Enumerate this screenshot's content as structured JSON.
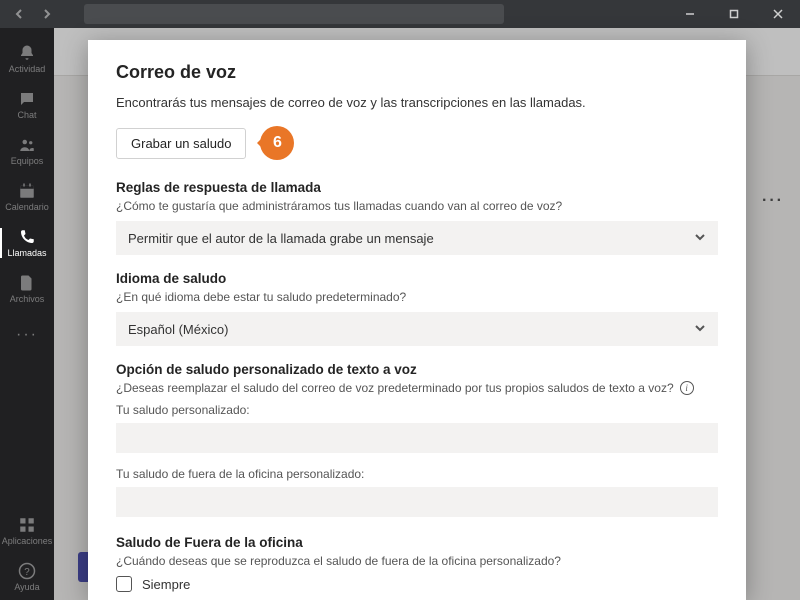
{
  "titlebar": {
    "nav_back_icon": "chevron-left",
    "nav_fwd_icon": "chevron-right"
  },
  "rail": {
    "items": [
      {
        "label": "Actividad",
        "icon": "bell"
      },
      {
        "label": "Chat",
        "icon": "chat"
      },
      {
        "label": "Equipos",
        "icon": "people"
      },
      {
        "label": "Calendario",
        "icon": "calendar"
      },
      {
        "label": "Llamadas",
        "icon": "phone"
      },
      {
        "label": "Archivos",
        "icon": "file"
      },
      {
        "label": "···",
        "icon": "more"
      }
    ],
    "bottom": [
      {
        "label": "Aplicaciones",
        "icon": "apps"
      },
      {
        "label": "Ayuda",
        "icon": "help"
      }
    ]
  },
  "bg": {
    "more_dots": "···"
  },
  "callout_number": "6",
  "modal": {
    "title": "Correo de voz",
    "description": "Encontrarás tus mensajes de correo de voz y las transcripciones en las llamadas.",
    "record_btn": "Grabar un saludo",
    "rules": {
      "title": "Reglas de respuesta de llamada",
      "sub": "¿Cómo te gustaría que administráramos tus llamadas cuando van al correo de voz?",
      "value": "Permitir que el autor de la llamada grabe un mensaje"
    },
    "lang": {
      "title": "Idioma de saludo",
      "sub": "¿En qué idioma debe estar tu saludo predeterminado?",
      "value": "Español (México)"
    },
    "tts": {
      "title": "Opción de saludo personalizado de texto a voz",
      "sub": "¿Deseas reemplazar el saludo del correo de voz predeterminado por tus propios saludos de texto a voz?",
      "field1_label": "Tu saludo personalizado:",
      "field1_value": "",
      "field2_label": "Tu saludo de fuera de la oficina personalizado:",
      "field2_value": ""
    },
    "oof": {
      "title": "Saludo de Fuera de la oficina",
      "sub": "¿Cuándo deseas que se reproduzca el saludo de fuera de la oficina personalizado?",
      "checkbox_label": "Siempre"
    }
  }
}
